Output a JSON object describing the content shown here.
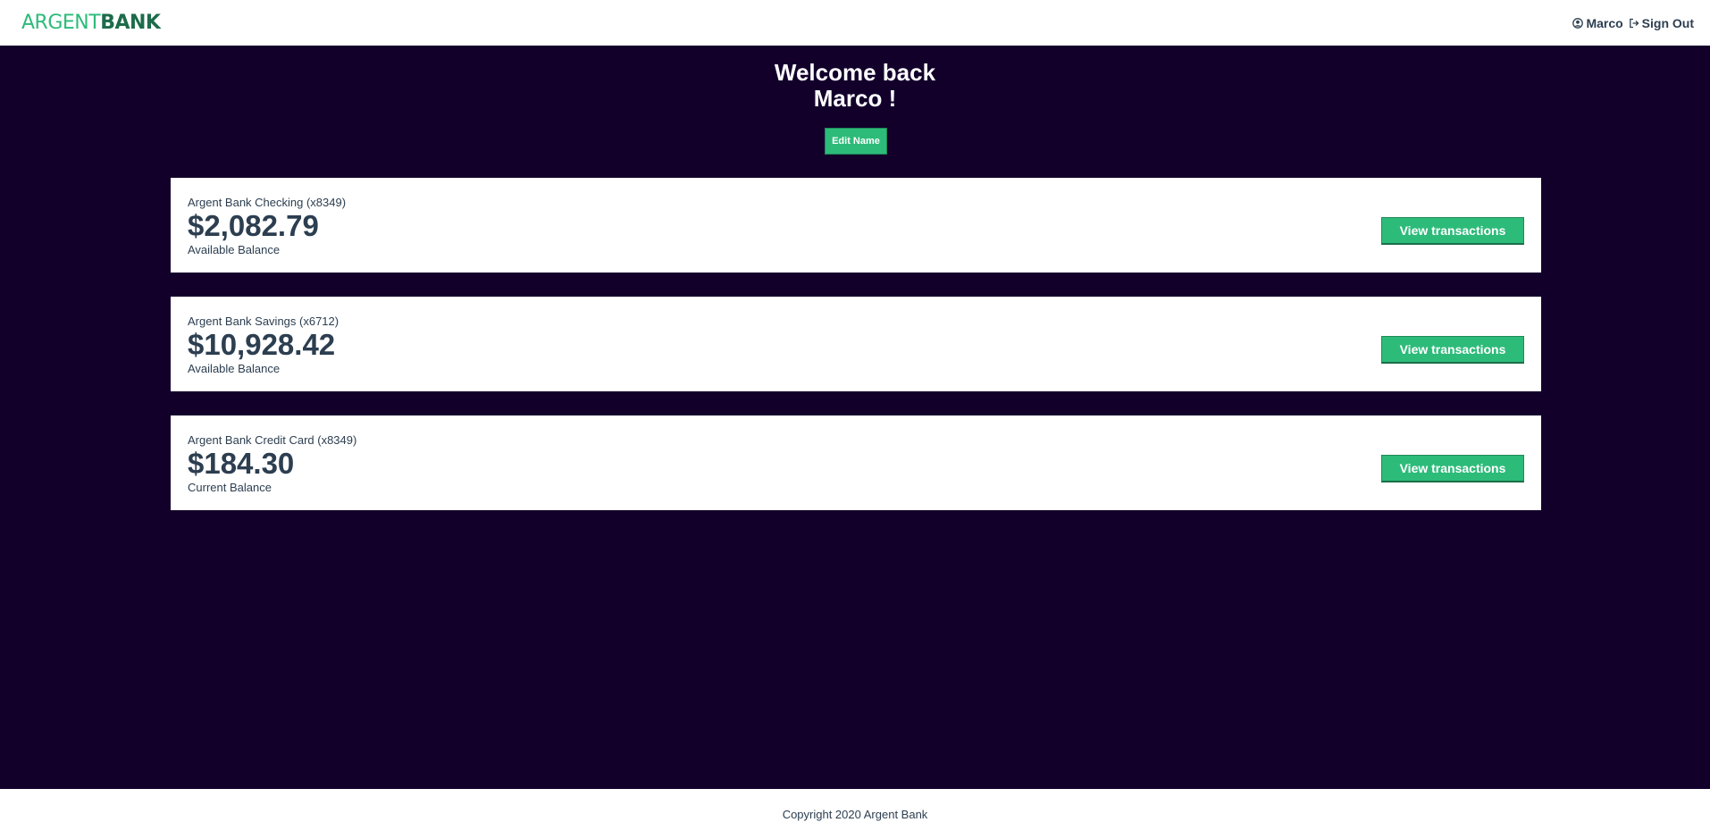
{
  "header": {
    "logo_part1": "ARGENT",
    "logo_part2": "BANK",
    "user_name": "Marco",
    "sign_out_label": "Sign Out"
  },
  "welcome": {
    "line1": "Welcome back",
    "line2": "Marco !",
    "edit_label": "Edit Name"
  },
  "accounts": [
    {
      "title": "Argent Bank Checking (x8349)",
      "amount": "$2,082.79",
      "description": "Available Balance",
      "button_label": "View transactions"
    },
    {
      "title": "Argent Bank Savings (x6712)",
      "amount": "$10,928.42",
      "description": "Available Balance",
      "button_label": "View transactions"
    },
    {
      "title": "Argent Bank Credit Card (x8349)",
      "amount": "$184.30",
      "description": "Current Balance",
      "button_label": "View transactions"
    }
  ],
  "footer": {
    "copyright": "Copyright 2020 Argent Bank"
  },
  "colors": {
    "accent": "#2dbb7a",
    "background_dark": "#12002b",
    "text": "#2c3e50"
  },
  "icons": {
    "user": "user-circle-icon",
    "sign_out": "sign-out-icon"
  }
}
